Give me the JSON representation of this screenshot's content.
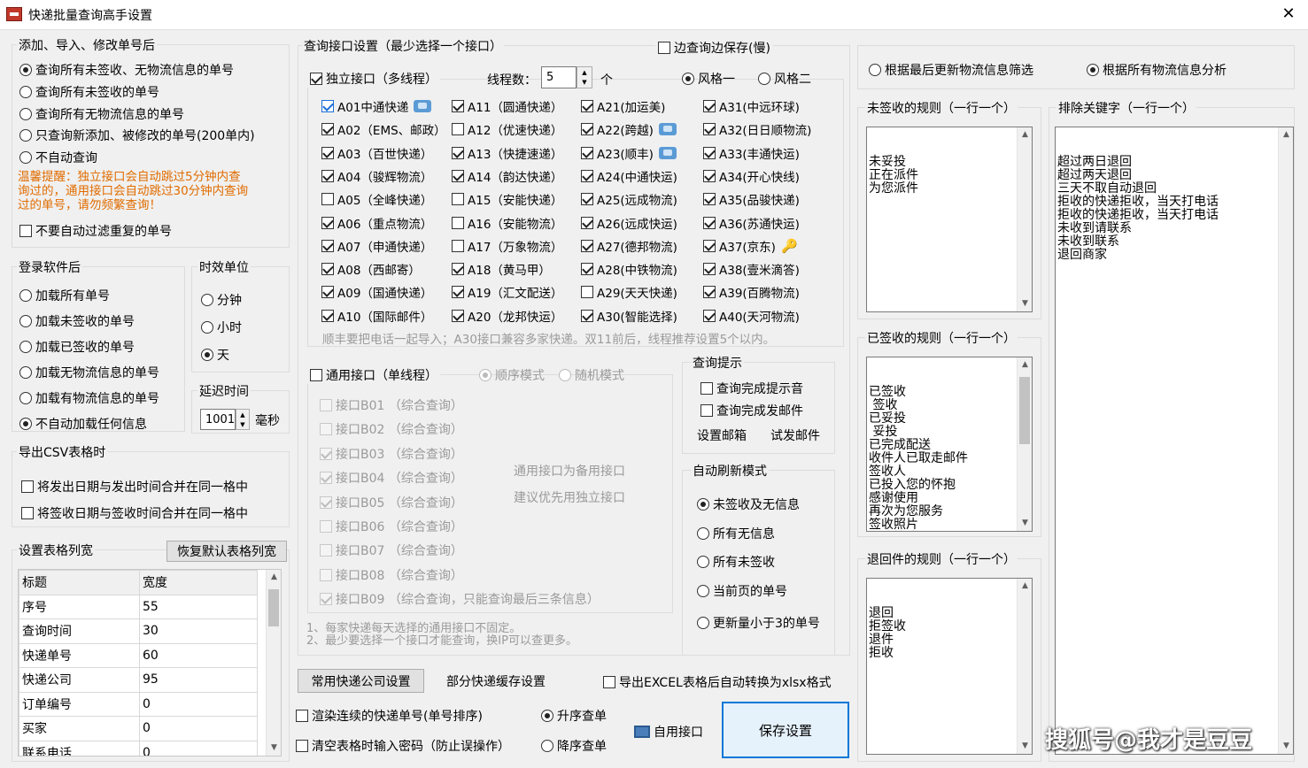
{
  "window": {
    "title": "快递批量查询高手设置",
    "close": "✕"
  },
  "add_import": {
    "label": "添加、导入、修改单号后",
    "options": [
      "查询所有未签收、无物流信息的单号",
      "查询所有未签收的单号",
      "查询所有无物流信息的单号",
      "只查询新添加、被修改的单号(200单内)",
      "不自动查询"
    ],
    "selected": 0,
    "warning_lines": [
      "温馨提醒：独立接口会自动跳过5分钟内查",
      "询过的，通用接口会自动跳过30分钟内查询",
      "过的单号，请勿频繁查询！"
    ],
    "no_auto_filter": "不要自动过滤重复的单号"
  },
  "login": {
    "label": "登录软件后",
    "options": [
      "加载所有单号",
      "加载未签收的单号",
      "加载已签收的单号",
      "加载无物流信息的单号",
      "加载有物流信息的单号",
      "不自动加载任何信息"
    ],
    "selected": 5
  },
  "time_unit": {
    "label": "时效单位",
    "options": [
      "分钟",
      "小时",
      "天"
    ],
    "selected": 2
  },
  "delay": {
    "label": "延迟时间",
    "value": "1001",
    "unit": "毫秒"
  },
  "csv": {
    "label": "导出CSV表格时",
    "options": [
      "将发出日期与发出时间合并在同一格中",
      "将签收日期与签收时间合并在同一格中"
    ]
  },
  "colwidth": {
    "label": "设置表格列宽",
    "reset_button": "恢复默认表格列宽",
    "headers": [
      "标题",
      "宽度"
    ],
    "rows": [
      [
        "序号",
        "55"
      ],
      [
        "查询时间",
        "30"
      ],
      [
        "快递单号",
        "60"
      ],
      [
        "快递公司",
        "95"
      ],
      [
        "订单编号",
        "0"
      ],
      [
        "买家",
        "0"
      ],
      [
        "联系电话",
        "0"
      ]
    ]
  },
  "iface": {
    "label": "查询接口设置（最少选择一个接口）",
    "save_while_query": "边查询边保存(慢)",
    "independent": "独立接口（多线程）",
    "threads_label": "线程数：",
    "threads_value": "5",
    "threads_unit": "个",
    "style1": "风格一",
    "style2": "风格二",
    "columns": [
      [
        {
          "t": "A01中通快递",
          "on": true,
          "blue": true,
          "icon": "tel"
        },
        {
          "t": "A02（EMS、邮政）",
          "on": true
        },
        {
          "t": "A03（百世快递）",
          "on": true
        },
        {
          "t": "A04（骏辉物流）",
          "on": true
        },
        {
          "t": "A05（全峰快递）",
          "on": false
        },
        {
          "t": "A06（重点物流）",
          "on": true
        },
        {
          "t": "A07（申通快递）",
          "on": true
        },
        {
          "t": "A08（西邮寄）",
          "on": true
        },
        {
          "t": "A09（国通快递）",
          "on": true
        },
        {
          "t": "A10（国际邮件）",
          "on": true
        }
      ],
      [
        {
          "t": "A11（圆通快递）",
          "on": true
        },
        {
          "t": "A12（优速快递）",
          "on": false
        },
        {
          "t": "A13（快捷速递）",
          "on": true
        },
        {
          "t": "A14（韵达快递）",
          "on": true
        },
        {
          "t": "A15（安能快递）",
          "on": false
        },
        {
          "t": "A16（安能物流）",
          "on": false
        },
        {
          "t": "A17（万象物流）",
          "on": false
        },
        {
          "t": "A18（黄马甲）",
          "on": true
        },
        {
          "t": "A19（汇文配送）",
          "on": true
        },
        {
          "t": "A20（龙邦快运）",
          "on": true
        }
      ],
      [
        {
          "t": "A21(加运美)",
          "on": true
        },
        {
          "t": "A22(跨越)",
          "on": true,
          "icon": "tel"
        },
        {
          "t": "A23(顺丰)",
          "on": true,
          "icon": "tel"
        },
        {
          "t": "A24(中通快运)",
          "on": true
        },
        {
          "t": "A25(远成物流)",
          "on": true
        },
        {
          "t": "A26(远成快运)",
          "on": true
        },
        {
          "t": "A27(德邦物流)",
          "on": true
        },
        {
          "t": "A28(中铁物流)",
          "on": true
        },
        {
          "t": "A29(天天快递)",
          "on": false
        },
        {
          "t": "A30(智能选择)",
          "on": true
        }
      ],
      [
        {
          "t": "A31(中远环球)",
          "on": true
        },
        {
          "t": "A32(日日顺物流)",
          "on": true
        },
        {
          "t": "A33(丰通快运)",
          "on": true
        },
        {
          "t": "A34(开心快线)",
          "on": true
        },
        {
          "t": "A35(品骏快递)",
          "on": true
        },
        {
          "t": "A36(苏通快运)",
          "on": true
        },
        {
          "t": "A37(京东)",
          "on": true,
          "icon": "key"
        },
        {
          "t": "A38(壹米滴答)",
          "on": true
        },
        {
          "t": "A39(百腾物流)",
          "on": true
        },
        {
          "t": "A40(天河物流)",
          "on": true
        }
      ]
    ],
    "note": "顺丰要把电话一起导入；A30接口兼容多家快递。双11前后，线程推荐设置5个以内。",
    "general": "通用接口（单线程）",
    "seq_mode": "顺序模式",
    "random_mode": "随机模式",
    "b_items": [
      {
        "t": "接口B01 （综合查询）",
        "on": false
      },
      {
        "t": "接口B02 （综合查询）",
        "on": false
      },
      {
        "t": "接口B03 （综合查询）",
        "on": true
      },
      {
        "t": "接口B04 （综合查询）",
        "on": true
      },
      {
        "t": "接口B05 （综合查询）",
        "on": true
      },
      {
        "t": "接口B06 （综合查询）",
        "on": false
      },
      {
        "t": "接口B07 （综合查询）",
        "on": false
      },
      {
        "t": "接口B08 （综合查询）",
        "on": false
      },
      {
        "t": "接口B09 （综合查询，只能查询最后三条信息）",
        "on": true
      }
    ],
    "b_hint1": "通用接口为备用接口",
    "b_hint2": "建议优先用独立接口",
    "footnote1": "1、每家快递每天选择的通用接口不固定。",
    "footnote2": "2、最少要选择一个接口才能查询，换IP可以查更多。"
  },
  "hint": {
    "label": "查询提示",
    "sound": "查询完成提示音",
    "mail": "查询完成发邮件",
    "setup_mail": "设置邮箱",
    "test_mail": "试发邮件"
  },
  "refresh": {
    "label": "自动刷新模式",
    "options": [
      "未签收及无信息",
      "所有无信息",
      "所有未签收",
      "当前页的单号",
      "更新量小于3的单号"
    ],
    "selected": 0
  },
  "bottom": {
    "common_settings": "常用快递公司设置",
    "cache_settings": "部分快递缓存设置",
    "xlsx_convert": "导出EXCEL表格后自动转换为xlsx格式",
    "render_sorted": "渲染连续的快递单号(单号排序)",
    "password_clear": "清空表格时输入密码（防止误操作）",
    "asc": "升序查单",
    "desc": "降序查单",
    "self_iface": "自用接口",
    "save": "保存设置"
  },
  "right": {
    "filter1": "根据最后更新物流信息筛选",
    "filter2": "根据所有物流信息分析",
    "unsigned_label": "未签收的规则（一行一个）",
    "unsigned_rules": "未妥投\n正在派件\n为您派件",
    "signed_label": "已签收的规则（一行一个）",
    "signed_rules": "已签收\n 签收\n已妥投\n 妥投\n已完成配送\n收件人已取走邮件\n签收人\n已投入您的怀抱\n感谢使用\n再次为您服务\n签收照片\n照片签收\n本人已签",
    "returned_label": "退回件的规则（一行一个）",
    "returned_rules": "退回\n拒签收\n退件\n拒收",
    "exclude_label": "排除关键字（一行一个）",
    "exclude_rules": "超过两日退回\n超过两天退回\n三天不取自动退回\n拒收的快递拒收，当天打电话\n拒收的快递拒收，当天打电话\n未收到请联系\n未收到联系\n退回商家"
  },
  "watermark": "搜狐号@我才是豆豆"
}
